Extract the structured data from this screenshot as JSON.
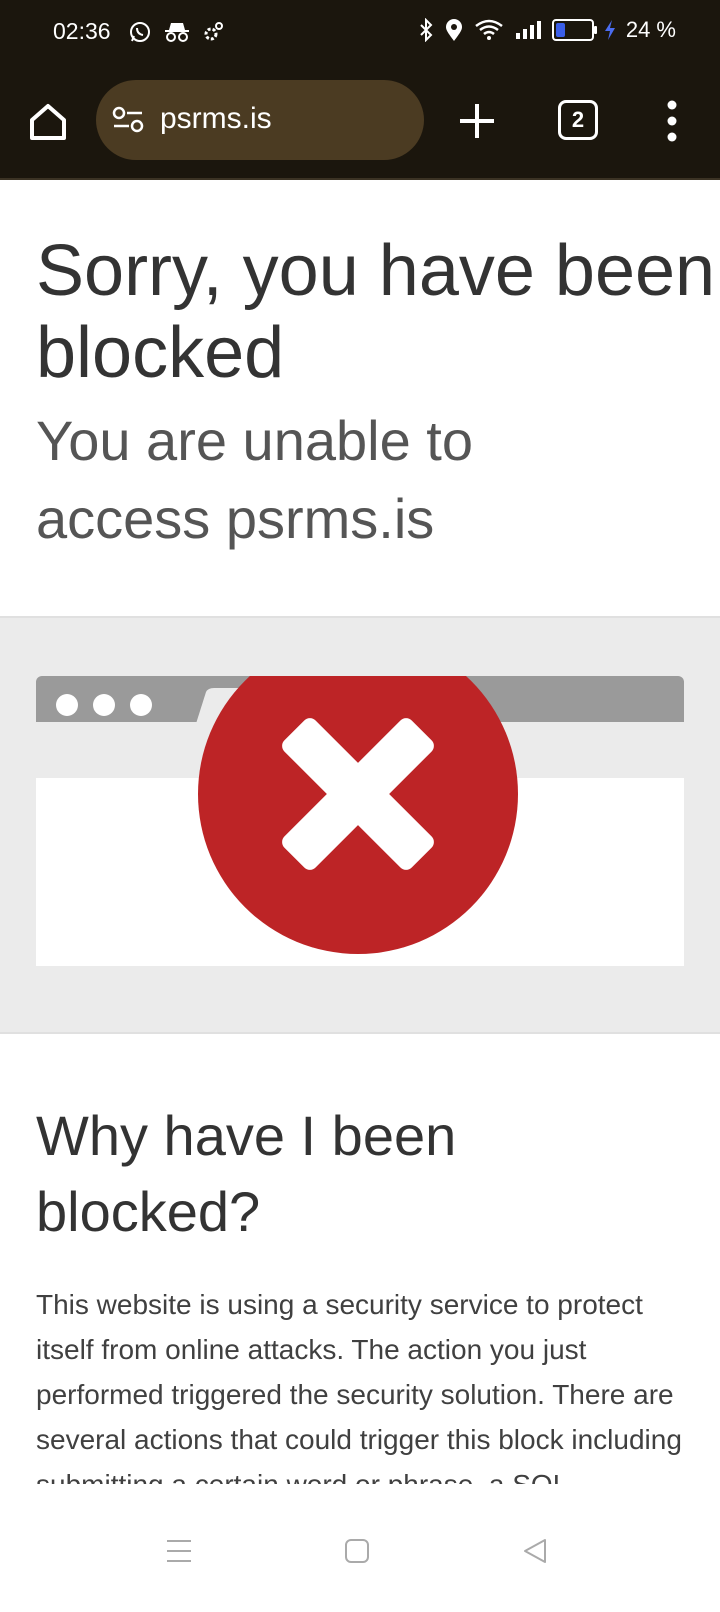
{
  "status_bar": {
    "time": "02:36",
    "battery_percent": "24 %",
    "icons": [
      "whatsapp-icon",
      "incognito-icon",
      "settings-icon",
      "bluetooth-icon",
      "location-icon",
      "wifi-icon",
      "signal-icon",
      "battery-icon",
      "charging-icon"
    ]
  },
  "browser": {
    "url": "psrms.is",
    "tab_count": "2",
    "icons": [
      "home-icon",
      "site-settings-icon",
      "new-tab-icon",
      "tab-switcher-icon",
      "menu-icon"
    ]
  },
  "content": {
    "title": "Sorry, you have been blocked",
    "subtitle": "You are unable to access psrms.is",
    "why_heading": "Why have I been blocked?",
    "why_text": "This website is using a security service to protect itself from online attacks. The action you just performed triggered the security solution. There are several actions that could trigger this block including submitting a certain word or phrase, a SQL command or malformed data."
  },
  "nav_bar": {
    "icons": [
      "recent-apps-icon",
      "home-nav-icon",
      "back-icon"
    ]
  },
  "colors": {
    "chrome_bg": "#1b160d",
    "omnibox_bg": "#4b3b22",
    "error_red": "#bd2426"
  }
}
